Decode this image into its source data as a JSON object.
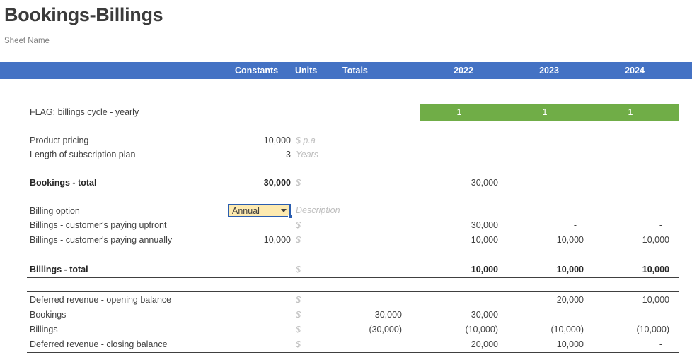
{
  "header": {
    "title": "Bookings-Billings",
    "subtitle": "Sheet Name"
  },
  "columns": {
    "constants": "Constants",
    "units": "Units",
    "totals": "Totals",
    "year1": "2022",
    "year2": "2023",
    "year3": "2024"
  },
  "colors": {
    "header_bar": "#4472c4",
    "flag_band": "#70ad47",
    "dropdown_fill": "#fdeab0",
    "selection_border": "#2a5db0"
  },
  "flag_row": {
    "label": "FLAG: billings cycle - yearly",
    "year1": "1",
    "year2": "1",
    "year3": "1"
  },
  "inputs": [
    {
      "label": "Product pricing",
      "constants": "10,000",
      "units": "$ p.a"
    },
    {
      "label": "Length of subscription plan",
      "constants": "3",
      "units": "Years"
    }
  ],
  "bookings_total": {
    "label": "Bookings - total",
    "constants": "30,000",
    "units": "$",
    "totals": "",
    "year1": "30,000",
    "year2": "-",
    "year3": "-"
  },
  "billing_option": {
    "label": "Billing option",
    "value": "Annual",
    "note": "Description",
    "dropdown_icon": "chevron-down-icon"
  },
  "billings_rows": [
    {
      "label": "Billings - customer's paying upfront",
      "constants": "",
      "units": "$",
      "year1": "30,000",
      "year2": "-",
      "year3": "-"
    },
    {
      "label": "Billings - customer's paying annually",
      "constants": "10,000",
      "units": "$",
      "year1": "10,000",
      "year2": "10,000",
      "year3": "10,000"
    }
  ],
  "billings_total": {
    "label": "Billings - total",
    "constants": "",
    "units": "$",
    "year1": "10,000",
    "year2": "10,000",
    "year3": "10,000"
  },
  "deferred_revenue": [
    {
      "label": "Deferred revenue - opening balance",
      "units": "$",
      "totals": "",
      "year1": "",
      "year2": "20,000",
      "year3": "10,000"
    },
    {
      "label": "Bookings",
      "units": "$",
      "totals": "30,000",
      "year1": "30,000",
      "year2": "-",
      "year3": "-"
    },
    {
      "label": "Billings",
      "units": "$",
      "totals": "(30,000)",
      "year1": "(10,000)",
      "year2": "(10,000)",
      "year3": "(10,000)"
    },
    {
      "label": "Deferred revenue - closing balance",
      "units": "$",
      "totals": "",
      "year1": "20,000",
      "year2": "10,000",
      "year3": "-"
    }
  ]
}
